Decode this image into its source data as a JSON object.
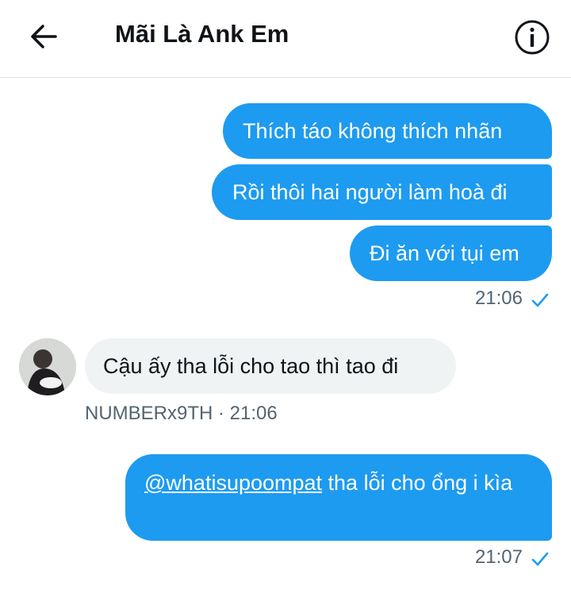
{
  "header": {
    "title": "Mãi Là Ank Em",
    "back_icon": "arrow-left-icon",
    "info_icon": "info-circle-icon"
  },
  "colors": {
    "outgoing_bubble": "#1d9bf0",
    "incoming_bubble": "#eff3f4",
    "meta_text": "#536471",
    "check": "#1d9bf0"
  },
  "messages": {
    "group1": [
      {
        "text": "Thích táo không thích nhãn"
      },
      {
        "text": "Rồi thôi hai người làm hoà đi"
      },
      {
        "text": "Đi ăn với tụi em"
      }
    ],
    "group1_time": "21:06",
    "incoming": {
      "text": "Cậu ấy tha lỗi cho tao thì tao đi",
      "sender": "NUMBERx9TH · 21:06"
    },
    "last": {
      "mention": "@whatisupoompat",
      "text": " tha lỗi cho ổng i kìa",
      "time": "21:07"
    }
  }
}
